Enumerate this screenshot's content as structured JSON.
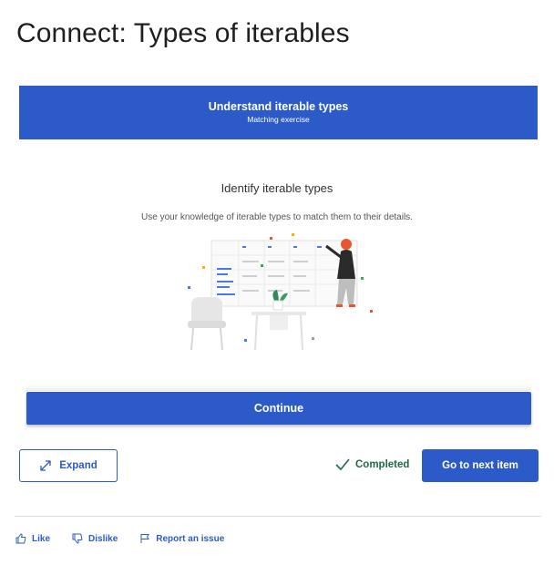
{
  "page": {
    "title": "Connect: Types of iterables"
  },
  "banner": {
    "title": "Understand iterable types",
    "subtitle": "Matching exercise"
  },
  "content": {
    "heading": "Identify iterable types",
    "description": "Use your knowledge of iterable types to match them to their details."
  },
  "buttons": {
    "continue_label": "Continue",
    "expand_label": "Expand",
    "next_label": "Go to next item"
  },
  "status": {
    "completed_label": "Completed",
    "color": "#1e6b45"
  },
  "feedback": {
    "like": "Like",
    "dislike": "Dislike",
    "report": "Report an issue"
  },
  "colors": {
    "accent": "#2c5bc9"
  }
}
